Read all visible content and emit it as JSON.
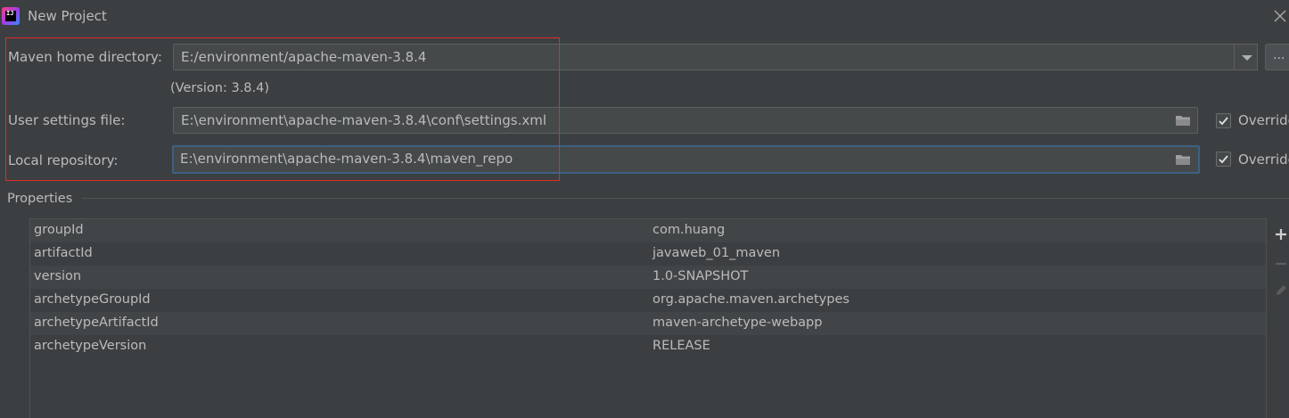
{
  "window": {
    "title": "New Project",
    "app_icon_text": "IJ"
  },
  "maven_home": {
    "label": "Maven home directory:",
    "value": "E:/environment/apache-maven-3.8.4",
    "version": "(Version: 3.8.4)",
    "browse_label": "..."
  },
  "user_settings": {
    "label": "User settings file:",
    "value": "E:\\environment\\apache-maven-3.8.4\\conf\\settings.xml",
    "override_label": "Override",
    "override_checked": true
  },
  "local_repo": {
    "label": "Local repository:",
    "value": "E:\\environment\\apache-maven-3.8.4\\maven_repo",
    "override_label": "Override",
    "override_checked": true
  },
  "properties": {
    "title": "Properties",
    "rows": [
      {
        "key": "groupId",
        "value": "com.huang"
      },
      {
        "key": "artifactId",
        "value": "javaweb_01_maven"
      },
      {
        "key": "version",
        "value": "1.0-SNAPSHOT"
      },
      {
        "key": "archetypeGroupId",
        "value": "org.apache.maven.archetypes"
      },
      {
        "key": "archetypeArtifactId",
        "value": "maven-archetype-webapp"
      },
      {
        "key": "archetypeVersion",
        "value": "RELEASE"
      }
    ]
  },
  "colors": {
    "background": "#3c3f41",
    "text": "#bbbbbb",
    "highlight": "#e12b2b",
    "focus": "#3d6185"
  },
  "icons": {
    "close": "close-icon",
    "dropdown": "chevron-down-icon",
    "folder": "folder-icon",
    "add": "plus-icon",
    "remove": "minus-icon",
    "edit": "pencil-icon"
  }
}
